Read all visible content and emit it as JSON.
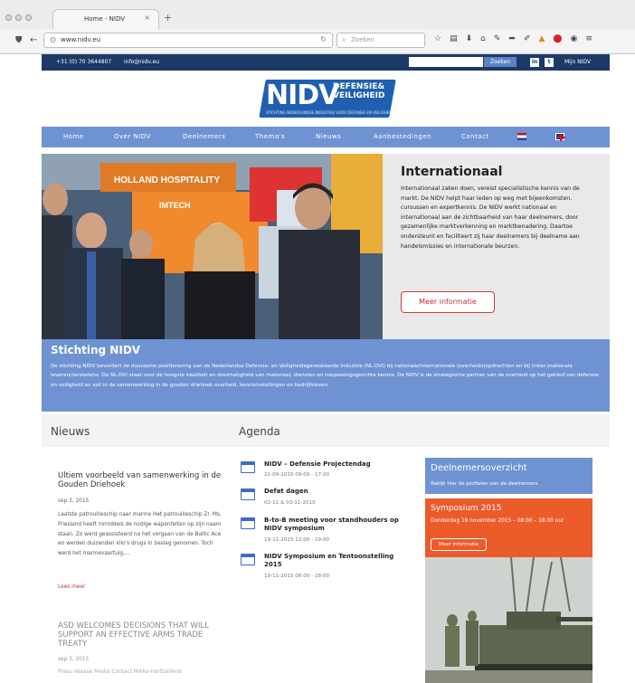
{
  "browser": {
    "tab_title": "Home - NIDV",
    "url": "www.nidv.eu",
    "search_placeholder": "Zoeken"
  },
  "topbar": {
    "phone": "+31 (0) 70 3644807",
    "email": "info@nidv.eu",
    "search_button": "Zoeken",
    "social_linkedin": "in",
    "social_twitter": "t",
    "mijn": "Mijn NIDV"
  },
  "logo": {
    "name": "NIDV",
    "line1": "DEFENSIE&",
    "line2": "VEILIGHEID",
    "tagline": "STICHTING NEDERLANDSE INDUSTRIE VOOR DEFENSIE EN VEILIGHEID"
  },
  "nav": {
    "items": [
      "Home",
      "Over NIDV",
      "Deelnemers",
      "Thema's",
      "Nieuws",
      "Aanbestedingen",
      "Contact"
    ]
  },
  "hero": {
    "title": "Internationaal",
    "body": "Internationaal zaken doen, vereist specialistische kennis van de markt. De NIDV helpt haar leden op weg met bijeenkomsten, cursussen en expertkennis. De NIDV werkt nationaal en internationaal aan de zichtbaarheid van haar deelnemers, door gezamenlijke marktverkenning en marktbenadering. Daartoe ondersteunt en faciliteert zij haar deelnemers bij deelname aan handelsmissies en internationale beurzen.",
    "button": "Meer informatie",
    "sign_text": "HOLLAND HOSPITALITY",
    "booth_text": "IMTECH"
  },
  "stichting": {
    "title": "Stichting NIDV",
    "body": "De stichting NIDV bevordert de duurzame positionering van de Nederlandse Defensie- en Veiligheidsgerelateerde Industrie (NL-DVI) bij nationale/internationale (overheids)opdrachten en bij (inter-)nationale leveranciersketens. De NL-DVI staat voor de hoogste kwaliteit en doelmatigheid van materieel, diensten en toepassingsgerichte kennis. De NIDV is de strategische partner van de overheid op het gebied van defensie en veiligheid en spil in de samenwerking in de gouden driehoek overheid, kennisinstellingen en bedrijfsleven."
  },
  "nieuws": {
    "heading": "Nieuws",
    "item1": {
      "title": "Ultiem voorbeeld van samenwerking in de Gouden Driehoek",
      "date": "sep 3, 2015",
      "body": "Laatste patrouilleschip naar marine Het patrouilleschip Zr. Ms. Friesland heeft inmiddels de nodige wapenfeiten op zijn naam staan. Zo werd geassisteerd na het vergaan van de Baltic Ace en werden duizenden kilo's drugs in beslag genomen. Toch werd het marinevaartuig,...",
      "more": "Lees meer"
    },
    "item2": {
      "title": "ASD WELCOMES DECISIONS THAT WILL SUPPORT AN EFFECTIVE ARMS TRADE TREATY",
      "date": "sep 3, 2015",
      "body": "Press release Media Contact Mikko-Harttaillend"
    }
  },
  "agenda": {
    "heading": "Agenda",
    "items": [
      {
        "title": "NIDV – Defensie Projectendag",
        "date": "22-09-2015 09:00 - 17:00"
      },
      {
        "title": "Defat dagen",
        "date": "02-11 & 03-11-2015"
      },
      {
        "title": "B-to-B meeting voor standhouders op NIDV symposium",
        "date": "19-11-2015 12:00 - 19:00"
      },
      {
        "title": "NIDV Symposium en Tentoonstelling 2015",
        "date": "19-11-2015 08:00 - 18:00"
      }
    ]
  },
  "sidebar": {
    "deelnemers_title": "Deelnemersoverzicht",
    "deelnemers_text": "Bekijk hier de profielen van de deelnemers.",
    "symposium_title": "Symposium 2015",
    "symposium_date": "Donderdag 19 november 2015 – 08:00 – 18:00 uur",
    "symposium_button": "Meer informatie"
  },
  "colors": {
    "navy": "#1b3a66",
    "nav_blue": "#6f93d2",
    "logo_blue": "#1f5fb0",
    "accent_red": "#d23b3b",
    "symposium_orange": "#ec5b2a"
  }
}
